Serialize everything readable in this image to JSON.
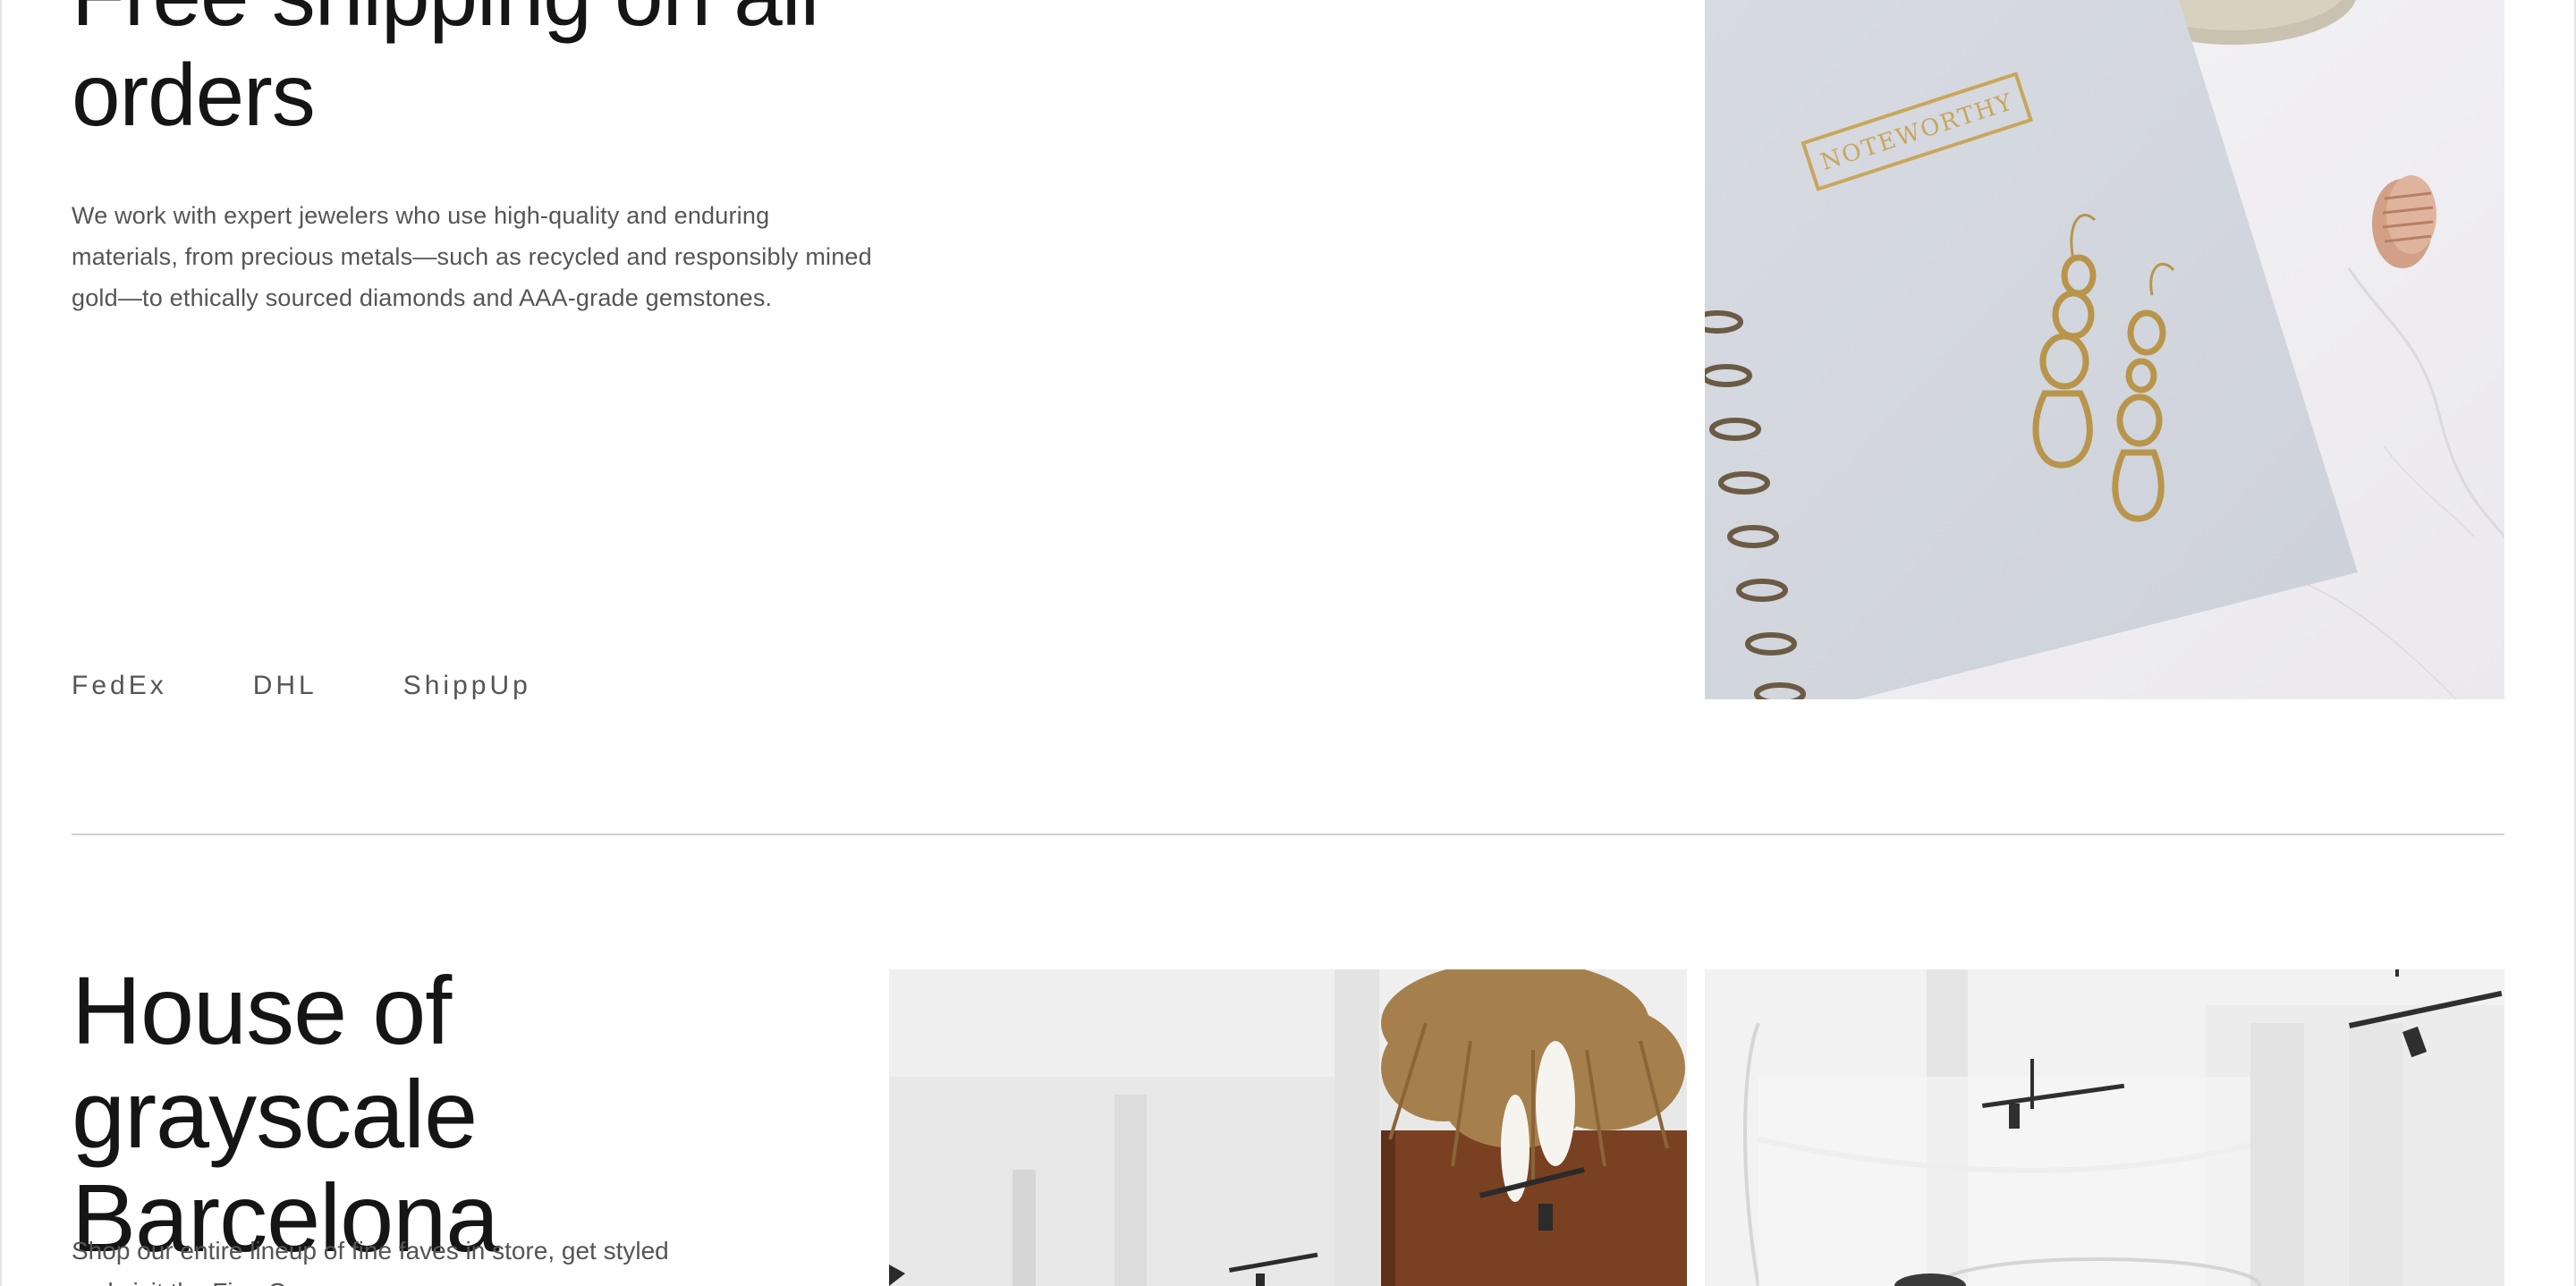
{
  "shipping": {
    "title": "Free shipping on all orders",
    "description": "We work with expert jewelers who use high-quality and enduring materials, from precious metals—such as recycled and responsibly mined gold—to ethically sourced diamonds and AAA-grade gemstones.",
    "carriers": [
      "FedEx",
      "DHL",
      "ShippUp"
    ],
    "image": {
      "stamp_text": "NOTEWORTHY"
    }
  },
  "store": {
    "title": "House of grayscale Barcelona",
    "description": "Shop our entire lineup of fine faves in store, get styled and visit the Fine Cave."
  },
  "colors": {
    "text_primary": "#151515",
    "text_secondary": "#555555",
    "divider": "#d0d0d0",
    "gold": "#b8954a"
  }
}
